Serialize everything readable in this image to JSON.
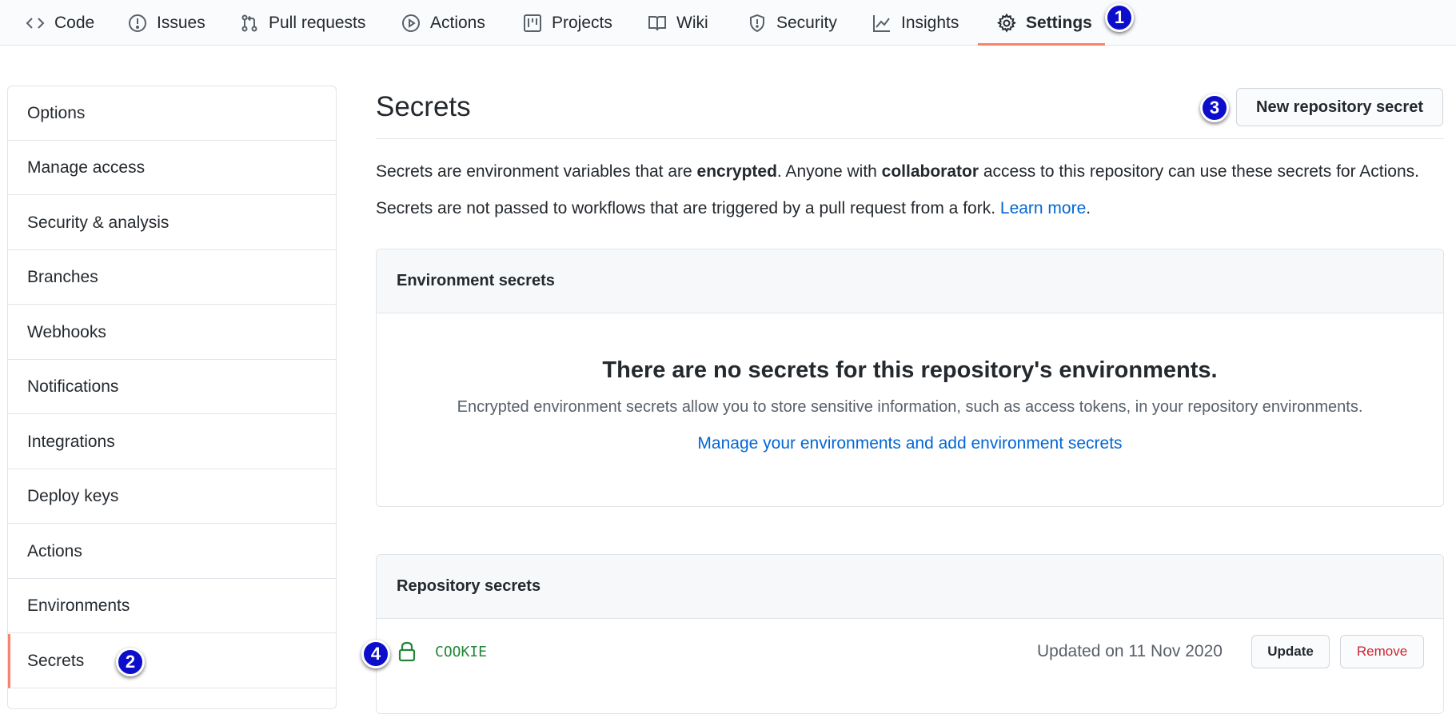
{
  "tabs": [
    {
      "label": "Code",
      "icon": "code-icon"
    },
    {
      "label": "Issues",
      "icon": "issue-icon"
    },
    {
      "label": "Pull requests",
      "icon": "pull-request-icon"
    },
    {
      "label": "Actions",
      "icon": "play-icon"
    },
    {
      "label": "Projects",
      "icon": "project-icon"
    },
    {
      "label": "Wiki",
      "icon": "book-icon"
    },
    {
      "label": "Security",
      "icon": "shield-icon"
    },
    {
      "label": "Insights",
      "icon": "graph-icon"
    },
    {
      "label": "Settings",
      "icon": "gear-icon",
      "active": true
    }
  ],
  "sidebar": {
    "items": [
      {
        "label": "Options"
      },
      {
        "label": "Manage access"
      },
      {
        "label": "Security & analysis"
      },
      {
        "label": "Branches"
      },
      {
        "label": "Webhooks"
      },
      {
        "label": "Notifications"
      },
      {
        "label": "Integrations"
      },
      {
        "label": "Deploy keys"
      },
      {
        "label": "Actions"
      },
      {
        "label": "Environments"
      },
      {
        "label": "Secrets",
        "selected": true
      }
    ]
  },
  "main": {
    "title": "Secrets",
    "new_button": "New repository secret",
    "intro": {
      "p1_a": "Secrets are environment variables that are ",
      "p1_b": "encrypted",
      "p1_c": ". Anyone with ",
      "p1_d": "collaborator",
      "p1_e": " access to this repository can use these secrets for Actions.",
      "p2_a": "Secrets are not passed to workflows that are triggered by a pull request from a fork. ",
      "p2_link": "Learn more",
      "p2_end": "."
    },
    "env_secrets": {
      "header": "Environment secrets",
      "blank_title": "There are no secrets for this repository's environments.",
      "blank_desc": "Encrypted environment secrets allow you to store sensitive information, such as access tokens, in your repository environments.",
      "blank_link": "Manage your environments and add environment secrets"
    },
    "repo_secrets": {
      "header": "Repository secrets",
      "rows": [
        {
          "name": "COOKIE",
          "updated": "Updated on 11 Nov 2020",
          "update_label": "Update",
          "remove_label": "Remove"
        }
      ]
    }
  },
  "annotations": {
    "b1": "1",
    "b2": "2",
    "b3": "3",
    "b4": "4"
  },
  "colors": {
    "accent": "#f9826c",
    "link": "#0366d6",
    "badge": "#0d0dcc",
    "danger": "#cb2431",
    "secret": "#22863a"
  }
}
